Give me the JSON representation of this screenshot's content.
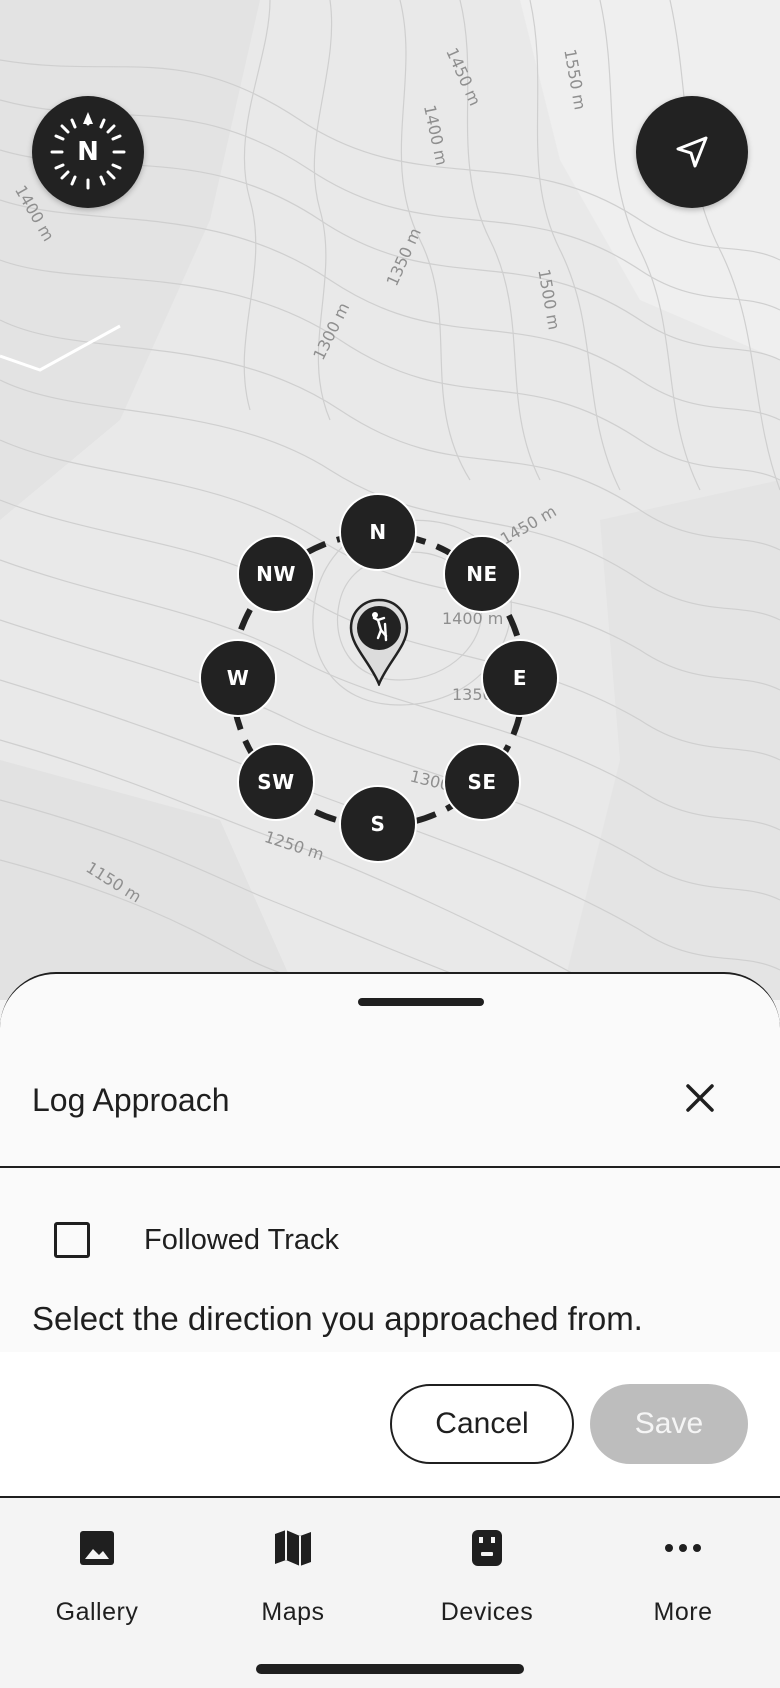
{
  "map": {
    "contour_labels": [
      "1450 m",
      "1550 m",
      "1400 m",
      "1400 m",
      "1350 m",
      "1500 m",
      "1300 m",
      "1450 m",
      "1400 m",
      "1350",
      "1300",
      "1250 m",
      "1150 m"
    ],
    "compass_letter": "N",
    "compass_icon": "compass-icon",
    "locate_icon": "navigation-arrow-icon",
    "pin_icon": "climber-pin-icon",
    "directions": [
      "N",
      "NE",
      "E",
      "SE",
      "S",
      "SW",
      "W",
      "NW"
    ]
  },
  "sheet": {
    "title": "Log Approach",
    "close_icon": "close-icon",
    "checkbox_label": "Followed Track",
    "checkbox_checked": false,
    "instruction": "Select the direction you approached from.",
    "cancel_label": "Cancel",
    "save_label": "Save"
  },
  "nav": {
    "items": [
      {
        "label": "Gallery",
        "icon": "image-icon"
      },
      {
        "label": "Maps",
        "icon": "map-icon"
      },
      {
        "label": "Devices",
        "icon": "device-icon"
      },
      {
        "label": "More",
        "icon": "more-icon"
      }
    ]
  },
  "colors": {
    "dark": "#222222",
    "map_bg": "#e8e8e8",
    "disabled": "#bdbdbd"
  }
}
